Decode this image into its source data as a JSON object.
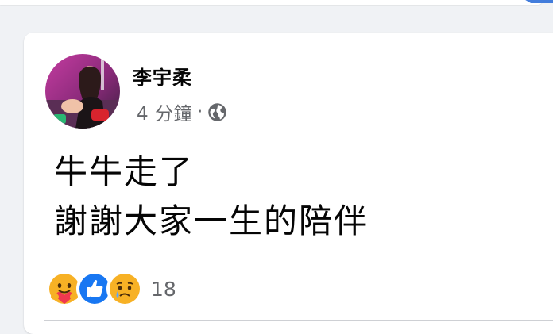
{
  "post": {
    "author": "李宇柔",
    "time": "4 分鐘",
    "separator": "·",
    "audience_icon": "globe-icon",
    "text_lines": [
      "牛牛走了",
      "謝謝大家一生的陪伴"
    ]
  },
  "reactions": {
    "icons": [
      "care-icon",
      "like-icon",
      "sad-icon"
    ],
    "count": "18"
  },
  "colors": {
    "page_background": "#f0f2f5",
    "card_background": "#ffffff",
    "primary_text": "#050505",
    "secondary_text": "#65676b",
    "like_blue": "#1877f2",
    "reaction_yellow": "#f7b125"
  }
}
